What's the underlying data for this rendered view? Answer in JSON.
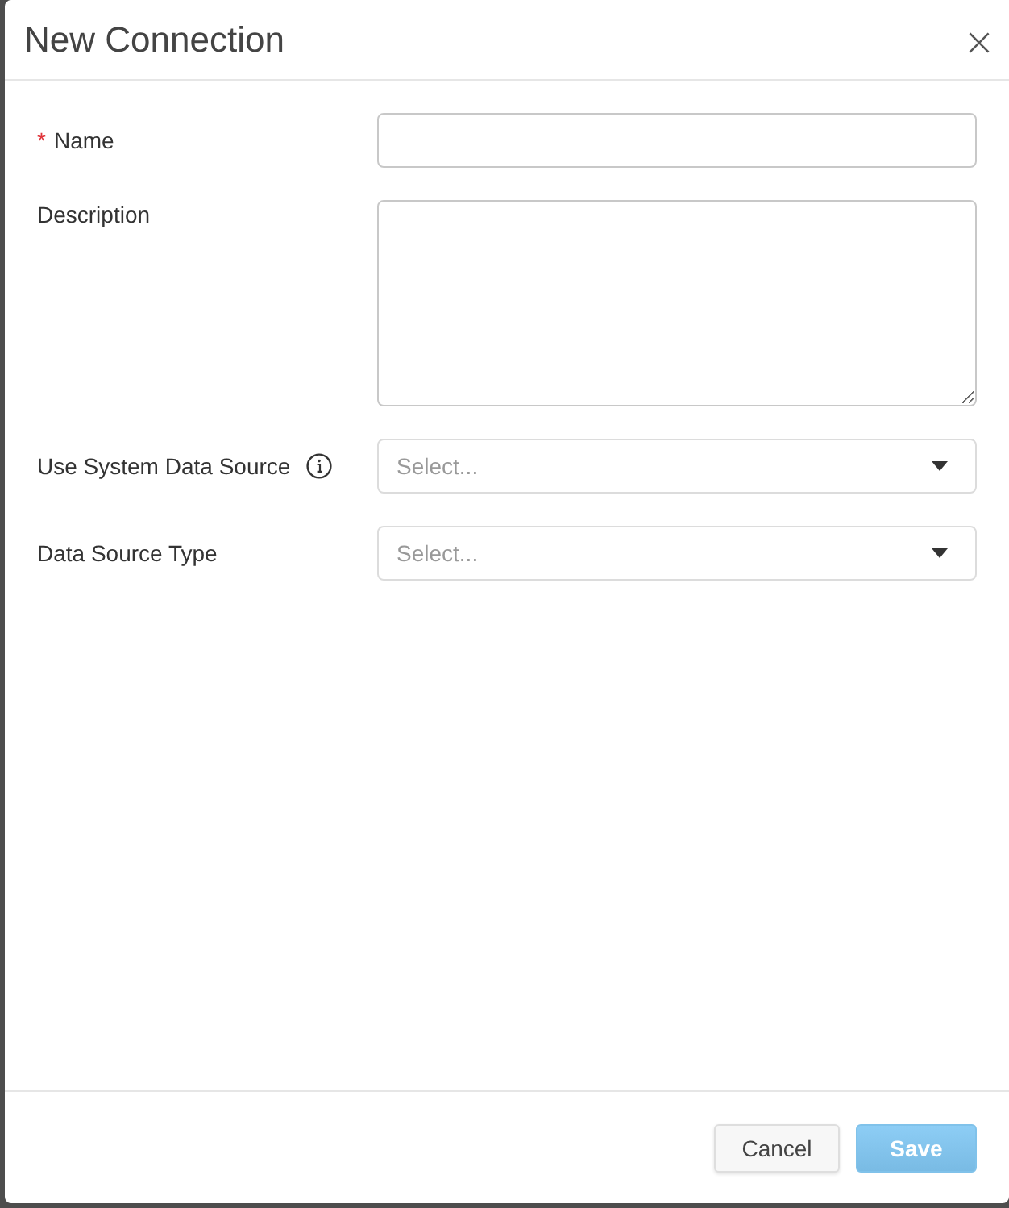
{
  "dialog": {
    "title": "New Connection",
    "fields": [
      {
        "kind": "text",
        "label": "Name",
        "required_mark": "*",
        "info": false
      },
      {
        "kind": "textarea",
        "label": "Description",
        "info": false
      },
      {
        "kind": "select",
        "label": "Use System Data Source",
        "info": true,
        "placeholder": "Select..."
      },
      {
        "kind": "select",
        "label": "Data Source Type",
        "info": false,
        "placeholder": "Select..."
      }
    ],
    "buttons": [
      {
        "kind": "secondary",
        "label": "Cancel",
        "disabled": false
      },
      {
        "kind": "primary",
        "label": "Save",
        "disabled": true
      }
    ]
  }
}
